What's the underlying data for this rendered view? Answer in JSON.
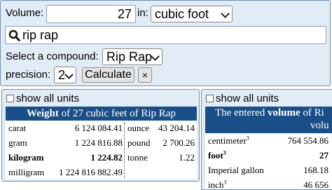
{
  "form": {
    "volume_label": "Volume:",
    "volume_value": "27",
    "in_label": "in:",
    "unit_selected": "cubic foot",
    "search_value": "rip rap",
    "compound_label": "Select a compound:",
    "compound_selected": "Rip Rap",
    "precision_label": "precision:",
    "precision_selected": "2",
    "calculate_label": "Calculate",
    "clear_label": "×"
  },
  "weight_table": {
    "show_all_label": "show all units",
    "title_bold": "Weight",
    "title_rest": " of 27 cubic feet of Rip Rap",
    "left": [
      {
        "unit": "carat",
        "value": "6 124 084.41"
      },
      {
        "unit": "gram",
        "value": "1 224 816.88"
      },
      {
        "unit": "kilogram",
        "value": "1 224.82"
      },
      {
        "unit": "milligram",
        "value": "1 224 816 882.49"
      }
    ],
    "right": [
      {
        "unit": "ounce",
        "value": "43 204.14"
      },
      {
        "unit": "pound",
        "value": "2 700.26"
      },
      {
        "unit": "tonne",
        "value": "1.22"
      }
    ]
  },
  "volume_table": {
    "show_all_label": "show all units",
    "title_line1_pre": "The entered ",
    "title_line1_bold": "volume",
    "title_line1_post": " of Ri",
    "title_line2": "volu",
    "rows": [
      {
        "unit": "centimeter",
        "sup": "3",
        "value": "764 554.86"
      },
      {
        "unit": "foot",
        "sup": "3",
        "value": "27"
      },
      {
        "unit": "Imperial gallon",
        "sup": "",
        "value": "168.18"
      },
      {
        "unit": "inch",
        "sup": "3",
        "value": "46 656"
      }
    ]
  },
  "colors": {
    "panel_bg": "#e2ecf6",
    "header_bg": "#1a4e86",
    "border": "#6f8fb4"
  }
}
